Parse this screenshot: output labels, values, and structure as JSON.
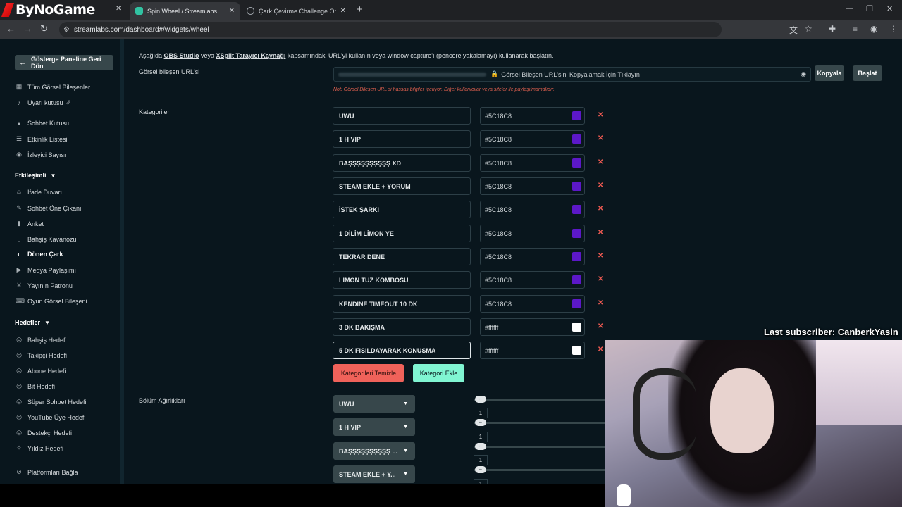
{
  "browser": {
    "logo_text": "ByNoGame",
    "tabs": [
      {
        "title": "Spin Wheel / Streamlabs",
        "fav_color": "#31c3a2"
      },
      {
        "title": "Çark Çevirme Challenge Öneril",
        "fav_color": "#9aa0a6"
      }
    ],
    "url": "streamlabs.com/dashboard#/widgets/wheel"
  },
  "sidebar": {
    "back_label": "Gösterge Paneline Geri Dön",
    "items_top": [
      {
        "label": "Tüm Görsel Bileşenler",
        "icon": "grid-icon"
      },
      {
        "label": "Uyarı kutusu",
        "icon": "bell-icon"
      },
      {
        "label": "Sohbet Kutusu",
        "icon": "chat-icon"
      },
      {
        "label": "Etkinlik Listesi",
        "icon": "list-icon"
      },
      {
        "label": "İzleyici Sayısı",
        "icon": "eye-icon"
      }
    ],
    "section_engagement": "Etkileşimli",
    "items_engagement": [
      {
        "label": "İfade Duvarı",
        "icon": "emoji-icon"
      },
      {
        "label": "Sohbet Öne Çıkanı",
        "icon": "pin-icon"
      },
      {
        "label": "Anket",
        "icon": "poll-icon"
      },
      {
        "label": "Bahşiş Kavanozu",
        "icon": "jar-icon"
      },
      {
        "label": "Dönen Çark",
        "icon": "wheel-icon"
      },
      {
        "label": "Medya Paylaşımı",
        "icon": "media-icon"
      },
      {
        "label": "Yayının Patronu",
        "icon": "wand-icon"
      },
      {
        "label": "Oyun Görsel Bileşeni",
        "icon": "gamepad-icon"
      }
    ],
    "section_goals": "Hedefler",
    "items_goals": [
      {
        "label": "Bahşiş Hedefi",
        "icon": "target-icon"
      },
      {
        "label": "Takipçi Hedefi",
        "icon": "target-icon"
      },
      {
        "label": "Abone Hedefi",
        "icon": "target-icon"
      },
      {
        "label": "Bit Hedefi",
        "icon": "target-icon"
      },
      {
        "label": "Süper Sohbet Hedefi",
        "icon": "target-icon"
      },
      {
        "label": "YouTube Üye Hedefi",
        "icon": "target-icon"
      },
      {
        "label": "Destekçi Hedefi",
        "icon": "target-icon"
      },
      {
        "label": "Yıldız Hedefi",
        "icon": "target-icon"
      }
    ],
    "platforms_label": "Platformları Bağla"
  },
  "main": {
    "intro": {
      "pre": "Aşağıda ",
      "obs": "OBS Studio",
      "mid": " veya ",
      "xsplit": "XSplit Tarayıcı Kaynağı",
      "post": " kapsamındaki URL'yi kullanın veya window capture'ı (pencere yakalamayı) kullanarak başlatın."
    },
    "url_label": "Görsel bileşen URL'si",
    "url_copy_hint": "Görsel Bileşen URL'sini Kopyalamak İçin Tıklayın",
    "copy_button": "Kopyala",
    "start_button": "Başlat",
    "url_note": "Not: Görsel Bileşen URL'si hassas bilgiler içeriyor. Diğer kullanıcılar veya siteler ile paylaşılmamalıdır.",
    "categories_label": "Kategoriler",
    "categories": [
      {
        "name": "UWU",
        "color": "#5C18C8"
      },
      {
        "name": "1 H VIP",
        "color": "#5C18C8"
      },
      {
        "name": "BAŞŞŞŞŞŞŞŞŞŞ XD",
        "color": "#5C18C8"
      },
      {
        "name": "STEAM EKLE + YORUM",
        "color": "#5C18C8"
      },
      {
        "name": "İSTEK ŞARKI",
        "color": "#5C18C8"
      },
      {
        "name": "1 DİLİM LİMON YE",
        "color": "#5C18C8"
      },
      {
        "name": "TEKRAR DENE",
        "color": "#5C18C8"
      },
      {
        "name": "LİMON TUZ KOMBOSU",
        "color": "#5C18C8"
      },
      {
        "name": "KENDİNE TIMEOUT 10 DK",
        "color": "#5C18C8"
      },
      {
        "name": "3 DK BAKIŞMA",
        "color": "#ffffff"
      },
      {
        "name": "5 DK FISILDAYARAK KONUSMA",
        "color": "#ffffff"
      }
    ],
    "clear_button": "Kategorileri Temizle",
    "add_button": "Kategori Ekle",
    "weights_label": "Bölüm Ağırlıkları",
    "weights": [
      {
        "name": "UWU",
        "value": "1"
      },
      {
        "name": "1 H VIP",
        "value": "1"
      },
      {
        "name": "BAŞŞŞŞŞŞŞŞŞŞ ...",
        "value": "1"
      },
      {
        "name": "STEAM EKLE + Y...",
        "value": "1"
      }
    ]
  },
  "overlay": {
    "last_subscriber": "Last subscriber: CanberkYasin"
  }
}
